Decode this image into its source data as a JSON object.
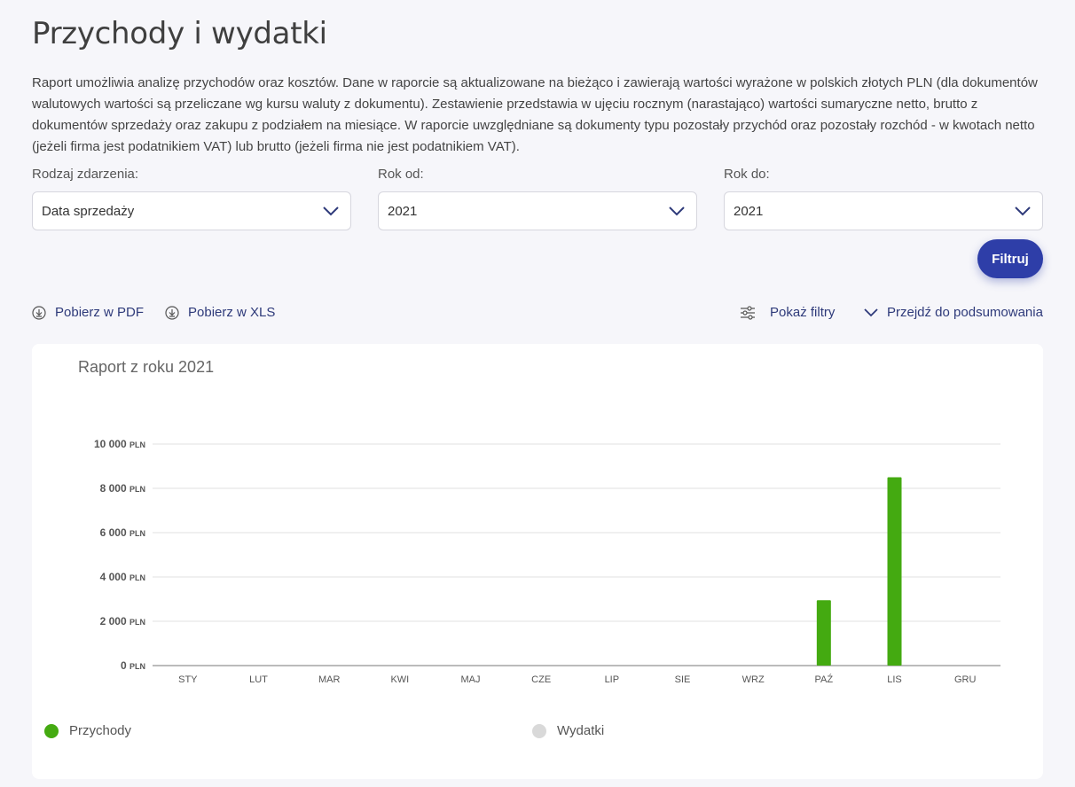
{
  "page": {
    "title": "Przychody i wydatki",
    "description": "Raport umożliwia analizę przychodów oraz kosztów. Dane w raporcie są aktualizowane na bieżąco i zawierają wartości wyrażone w polskich złotych PLN (dla dokumentów walutowych wartości są przeliczane wg kursu waluty z dokumentu). Zestawienie przedstawia w ujęciu rocznym (narastająco) wartości sumaryczne netto, brutto z dokumentów sprzedaży oraz zakupu z podziałem na miesiące. W raporcie uwzględniane są dokumenty typu pozostały przychód oraz pozostały rozchód - w kwotach netto (jeżeli firma jest podatnikiem VAT) lub brutto (jeżeli firma nie jest podatnikiem VAT)."
  },
  "filters": {
    "event_type": {
      "label": "Rodzaj zdarzenia:",
      "value": "Data sprzedaży"
    },
    "year_from": {
      "label": "Rok od:",
      "value": "2021"
    },
    "year_to": {
      "label": "Rok do:",
      "value": "2021"
    },
    "submit_label": "Filtruj"
  },
  "actions": {
    "pdf_label": "Pobierz w PDF",
    "xls_label": "Pobierz w XLS",
    "show_filters_label": "Pokaż filtry",
    "go_to_summary_label": "Przejdź do podsumowania"
  },
  "icons": {
    "download": "download-circle-icon",
    "sliders": "sliders-icon",
    "chevron": "chevron-down-icon"
  },
  "colors": {
    "primary": "#2e3ea8",
    "income": "#44aa11",
    "expenses": "#d9d9d9"
  },
  "chart_data": {
    "type": "bar",
    "title": "Raport z roku 2021",
    "categories": [
      "STY",
      "LUT",
      "MAR",
      "KWI",
      "MAJ",
      "CZE",
      "LIP",
      "SIE",
      "WRZ",
      "PAŹ",
      "LIS",
      "GRU"
    ],
    "series": [
      {
        "name": "Przychody",
        "color": "#44aa11",
        "values": [
          0,
          0,
          0,
          0,
          0,
          0,
          0,
          0,
          0,
          2950,
          8500,
          0
        ]
      },
      {
        "name": "Wydatki",
        "color": "#d9d9d9",
        "values": [
          0,
          0,
          0,
          0,
          0,
          0,
          0,
          0,
          0,
          0,
          0,
          0
        ]
      }
    ],
    "yticks": [
      {
        "value": 0,
        "label": "0",
        "unit": "PLN"
      },
      {
        "value": 2000,
        "label": "2 000",
        "unit": "PLN"
      },
      {
        "value": 4000,
        "label": "4 000",
        "unit": "PLN"
      },
      {
        "value": 6000,
        "label": "6 000",
        "unit": "PLN"
      },
      {
        "value": 8000,
        "label": "8 000",
        "unit": "PLN"
      },
      {
        "value": 10000,
        "label": "10 000",
        "unit": "PLN"
      }
    ],
    "ylim": [
      0,
      10000
    ],
    "grid": true,
    "legend": "bottom"
  }
}
